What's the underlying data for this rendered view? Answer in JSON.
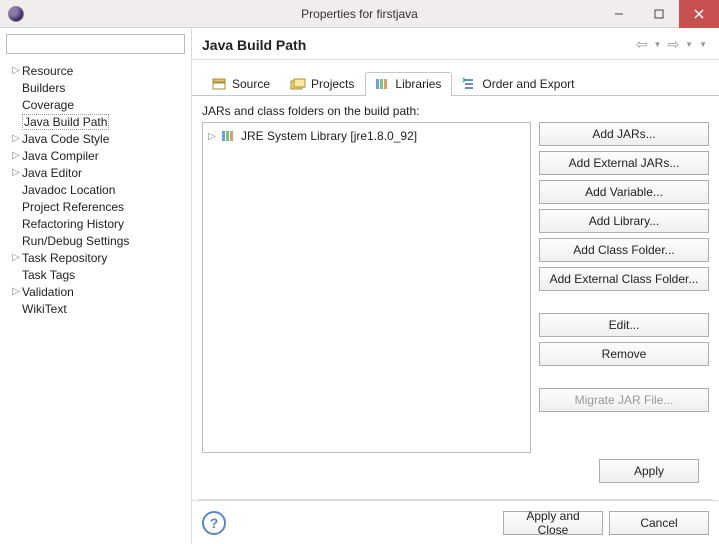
{
  "window": {
    "title": "Properties for firstjava"
  },
  "sidebar": {
    "filter_value": "",
    "items": [
      {
        "label": "Resource",
        "expandable": true
      },
      {
        "label": "Builders",
        "expandable": false
      },
      {
        "label": "Coverage",
        "expandable": false
      },
      {
        "label": "Java Build Path",
        "expandable": false,
        "selected": true
      },
      {
        "label": "Java Code Style",
        "expandable": true
      },
      {
        "label": "Java Compiler",
        "expandable": true
      },
      {
        "label": "Java Editor",
        "expandable": true
      },
      {
        "label": "Javadoc Location",
        "expandable": false
      },
      {
        "label": "Project References",
        "expandable": false
      },
      {
        "label": "Refactoring History",
        "expandable": false
      },
      {
        "label": "Run/Debug Settings",
        "expandable": false
      },
      {
        "label": "Task Repository",
        "expandable": true
      },
      {
        "label": "Task Tags",
        "expandable": false
      },
      {
        "label": "Validation",
        "expandable": true
      },
      {
        "label": "WikiText",
        "expandable": false
      }
    ]
  },
  "page": {
    "heading": "Java Build Path",
    "tabs": [
      {
        "label": "Source",
        "active": false
      },
      {
        "label": "Projects",
        "active": false
      },
      {
        "label": "Libraries",
        "active": true
      },
      {
        "label": "Order and Export",
        "active": false
      }
    ],
    "description": "JARs and class folders on the build path:",
    "library_items": [
      {
        "label": "JRE System Library [jre1.8.0_92]"
      }
    ],
    "buttons": {
      "add_jars": "Add JARs...",
      "add_external_jars": "Add External JARs...",
      "add_variable": "Add Variable...",
      "add_library": "Add Library...",
      "add_class_folder": "Add Class Folder...",
      "add_external_class_folder": "Add External Class Folder...",
      "edit": "Edit...",
      "remove": "Remove",
      "migrate": "Migrate JAR File..."
    },
    "apply": "Apply"
  },
  "footer": {
    "apply_close": "Apply and Close",
    "cancel": "Cancel"
  }
}
